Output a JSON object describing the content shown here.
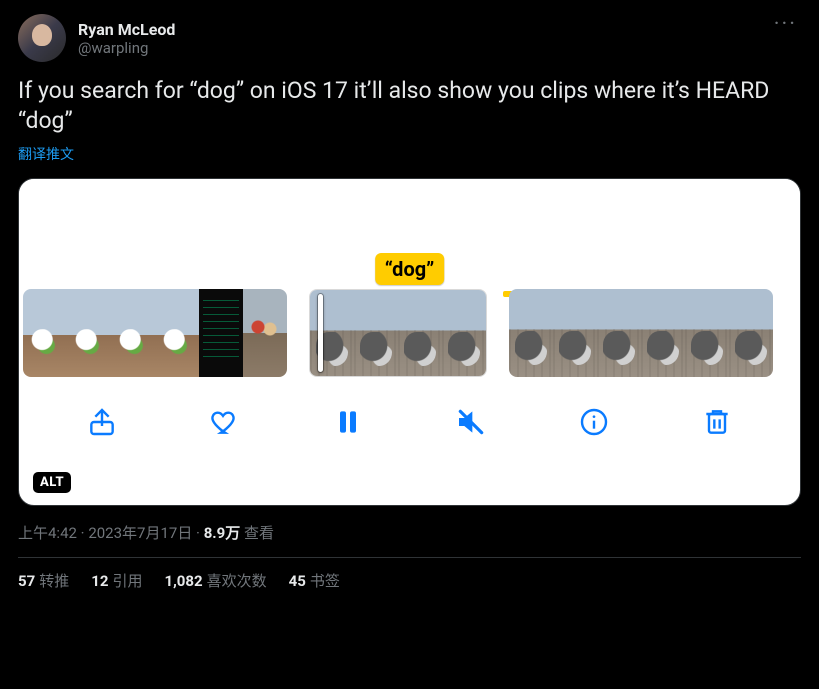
{
  "author": {
    "display_name": "Ryan McLeod",
    "handle": "@warpling"
  },
  "body": "If you search for “dog” on iOS 17 it’ll also show you clips where it’s HEARD “dog”",
  "translate_label": "翻译推文",
  "media": {
    "caption_chip": "“dog”",
    "alt_badge": "ALT",
    "toolbar_icons": [
      "share-icon",
      "heart-icon",
      "pause-icon",
      "mute-icon",
      "info-icon",
      "trash-icon"
    ]
  },
  "meta": {
    "time": "上午4:42",
    "date": "2023年7月17日",
    "views_count": "8.9万",
    "views_label": "查看",
    "sep": " · "
  },
  "stats": {
    "retweets": {
      "count": "57",
      "label": "转推"
    },
    "quotes": {
      "count": "12",
      "label": "引用"
    },
    "likes": {
      "count": "1,082",
      "label": "喜欢次数"
    },
    "bookmarks": {
      "count": "45",
      "label": "书签"
    }
  },
  "more_glyph": "···"
}
